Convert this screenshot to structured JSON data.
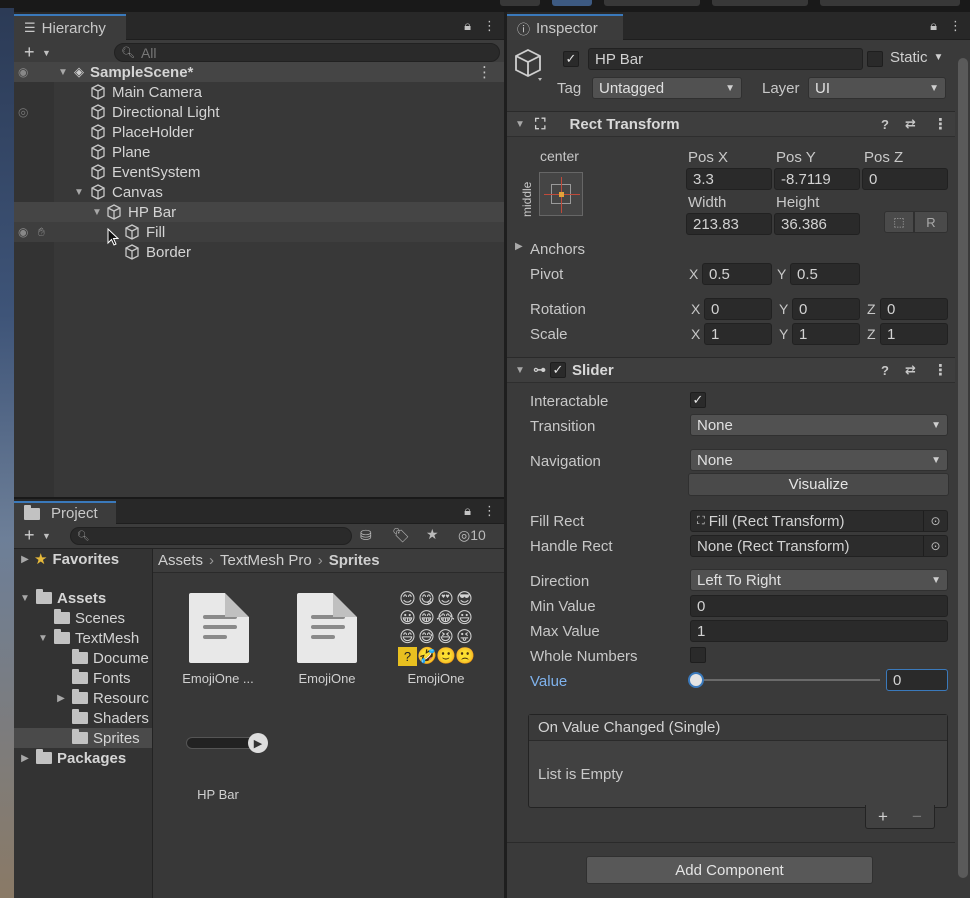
{
  "hierarchy": {
    "tab_label": "Hierarchy",
    "search_placeholder": "All",
    "scene_name": "SampleScene*",
    "items": [
      {
        "label": "Main Camera"
      },
      {
        "label": "Directional Light"
      },
      {
        "label": "PlaceHolder"
      },
      {
        "label": "Plane"
      },
      {
        "label": "EventSystem"
      },
      {
        "label": "Canvas"
      },
      {
        "label": "HP Bar"
      },
      {
        "label": "Fill"
      },
      {
        "label": "Border"
      }
    ]
  },
  "project": {
    "tab_label": "Project",
    "hidden_count": "10",
    "tree": {
      "favorites": "Favorites",
      "assets": "Assets",
      "scenes": "Scenes",
      "textmesh": "TextMesh",
      "docs": "Docume",
      "fonts": "Fonts",
      "resources": "Resourc",
      "shaders": "Shaders",
      "sprites": "Sprites",
      "packages": "Packages"
    },
    "breadcrumb": [
      "Assets",
      "TextMesh Pro",
      "Sprites"
    ],
    "assets": [
      {
        "label": "EmojiOne ..."
      },
      {
        "label": "EmojiOne"
      },
      {
        "label": "EmojiOne"
      },
      {
        "label": "HP Bar"
      }
    ]
  },
  "inspector": {
    "tab_label": "Inspector",
    "object_name": "HP Bar",
    "static_label": "Static",
    "tag_label": "Tag",
    "tag_value": "Untagged",
    "layer_label": "Layer",
    "layer_value": "UI",
    "rect": {
      "title": "Rect Transform",
      "anchor_h": "center",
      "anchor_v": "middle",
      "pos_x_label": "Pos X",
      "pos_x": "3.3",
      "pos_y_label": "Pos Y",
      "pos_y": "-8.7119",
      "pos_z_label": "Pos Z",
      "pos_z": "0",
      "width_label": "Width",
      "width": "213.83",
      "height_label": "Height",
      "height": "36.386",
      "r_button": "R",
      "anchors": "Anchors",
      "pivot": "Pivot",
      "pivot_x": "0.5",
      "pivot_y": "0.5",
      "rotation": "Rotation",
      "rot_x": "0",
      "rot_y": "0",
      "rot_z": "0",
      "scale": "Scale",
      "scale_x": "1",
      "scale_y": "1",
      "scale_z": "1",
      "x": "X",
      "y": "Y",
      "z": "Z"
    },
    "slider": {
      "title": "Slider",
      "interactable": "Interactable",
      "transition": "Transition",
      "transition_value": "None",
      "navigation": "Navigation",
      "navigation_value": "None",
      "visualize": "Visualize",
      "fill_rect": "Fill Rect",
      "fill_rect_value": "Fill (Rect Transform)",
      "handle_rect": "Handle Rect",
      "handle_rect_value": "None (Rect Transform)",
      "direction": "Direction",
      "direction_value": "Left To Right",
      "min_value": "Min Value",
      "min_value_value": "0",
      "max_value": "Max Value",
      "max_value_value": "1",
      "whole_numbers": "Whole Numbers",
      "value": "Value",
      "value_value": "0",
      "slider_fraction": 0
    },
    "event": {
      "title": "On Value Changed (Single)",
      "empty": "List is Empty",
      "plus": "+",
      "minus": "−"
    },
    "add_component": "Add Component"
  },
  "colors": {
    "accent": "#3a79bb",
    "value_label": "#7fb2ec"
  }
}
